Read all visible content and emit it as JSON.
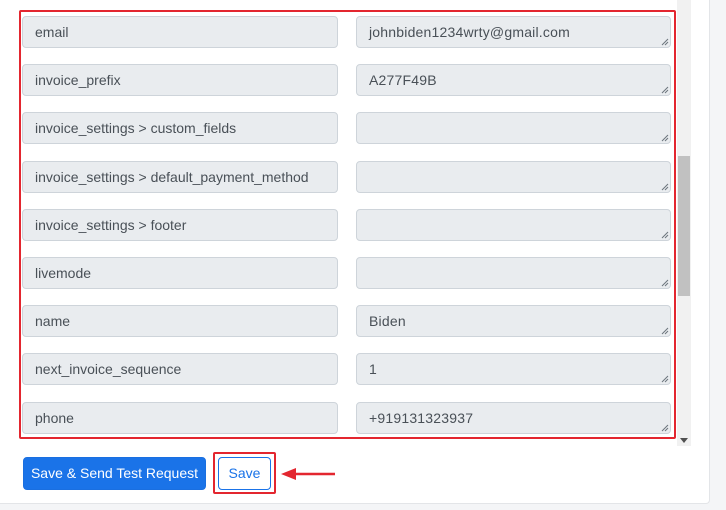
{
  "fields": [
    {
      "key": "email",
      "value": "johnbiden1234wrty@gmail.com"
    },
    {
      "key": "invoice_prefix",
      "value": "A277F49B"
    },
    {
      "key": "invoice_settings > custom_fields",
      "value": ""
    },
    {
      "key": "invoice_settings > default_payment_method",
      "value": ""
    },
    {
      "key": "invoice_settings > footer",
      "value": ""
    },
    {
      "key": "livemode",
      "value": ""
    },
    {
      "key": "name",
      "value": "Biden"
    },
    {
      "key": "next_invoice_sequence",
      "value": "1"
    },
    {
      "key": "phone",
      "value": "+919131323937"
    }
  ],
  "actions": {
    "save_send_label": "Save & Send Test Request",
    "save_label": "Save"
  },
  "colors": {
    "primary": "#1a73e8",
    "highlight": "#e3262f",
    "field_bg": "#e9ecef"
  }
}
